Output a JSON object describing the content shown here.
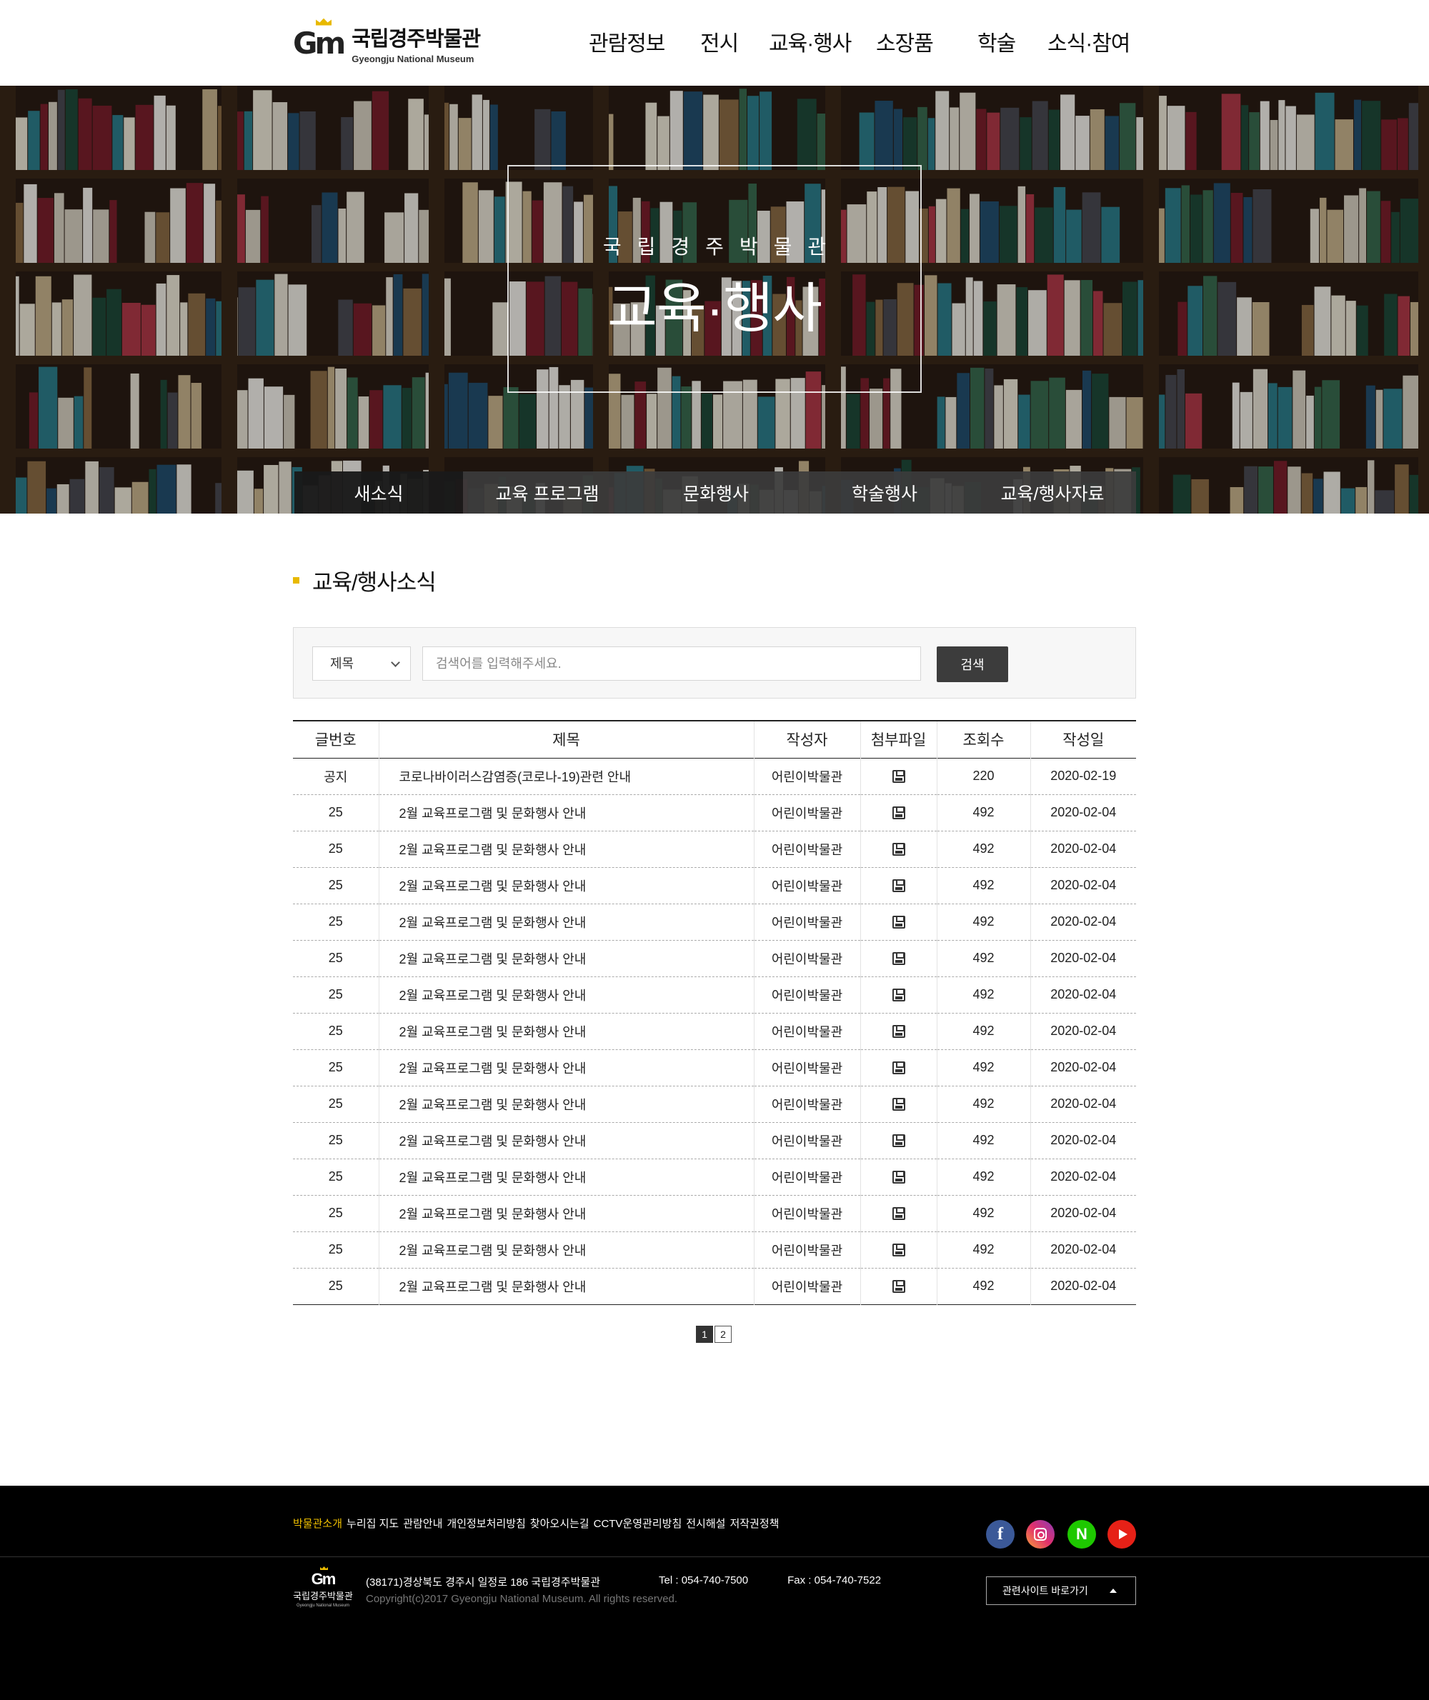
{
  "header": {
    "logo_mark": "Gm",
    "logo_ko": "국립경주박물관",
    "logo_en": "Gyeongju National Museum",
    "gnb": [
      "관람정보",
      "전시",
      "교육·행사",
      "소장품",
      "학술",
      "소식·참여"
    ]
  },
  "hero": {
    "subtitle": "국립경주박물관",
    "title": "교육·행사",
    "tabs": [
      "새소식",
      "교육 프로그램",
      "문화행사",
      "학술행사",
      "교육/행사자료"
    ],
    "active_tab": 0
  },
  "section": {
    "title": "교육/행사소식",
    "accent_color": "#e8b900"
  },
  "search": {
    "select_value": "제목",
    "placeholder": "검색어를 입력해주세요.",
    "button": "검색"
  },
  "board": {
    "columns": [
      "글번호",
      "제목",
      "작성자",
      "첨부파일",
      "조회수",
      "작성일"
    ],
    "rows": [
      {
        "num": "공지",
        "title": "코로나바이러스감염증(코로나-19)관련 안내",
        "author": "어린이박물관",
        "views": "220",
        "date": "2020-02-19"
      },
      {
        "num": "25",
        "title": "2월 교육프로그램 및 문화행사 안내",
        "author": "어린이박물관",
        "views": "492",
        "date": "2020-02-04"
      },
      {
        "num": "25",
        "title": "2월 교육프로그램 및 문화행사 안내",
        "author": "어린이박물관",
        "views": "492",
        "date": "2020-02-04"
      },
      {
        "num": "25",
        "title": "2월 교육프로그램 및 문화행사 안내",
        "author": "어린이박물관",
        "views": "492",
        "date": "2020-02-04"
      },
      {
        "num": "25",
        "title": "2월 교육프로그램 및 문화행사 안내",
        "author": "어린이박물관",
        "views": "492",
        "date": "2020-02-04"
      },
      {
        "num": "25",
        "title": "2월 교육프로그램 및 문화행사 안내",
        "author": "어린이박물관",
        "views": "492",
        "date": "2020-02-04"
      },
      {
        "num": "25",
        "title": "2월 교육프로그램 및 문화행사 안내",
        "author": "어린이박물관",
        "views": "492",
        "date": "2020-02-04"
      },
      {
        "num": "25",
        "title": "2월 교육프로그램 및 문화행사 안내",
        "author": "어린이박물관",
        "views": "492",
        "date": "2020-02-04"
      },
      {
        "num": "25",
        "title": "2월 교육프로그램 및 문화행사 안내",
        "author": "어린이박물관",
        "views": "492",
        "date": "2020-02-04"
      },
      {
        "num": "25",
        "title": "2월 교육프로그램 및 문화행사 안내",
        "author": "어린이박물관",
        "views": "492",
        "date": "2020-02-04"
      },
      {
        "num": "25",
        "title": "2월 교육프로그램 및 문화행사 안내",
        "author": "어린이박물관",
        "views": "492",
        "date": "2020-02-04"
      },
      {
        "num": "25",
        "title": "2월 교육프로그램 및 문화행사 안내",
        "author": "어린이박물관",
        "views": "492",
        "date": "2020-02-04"
      },
      {
        "num": "25",
        "title": "2월 교육프로그램 및 문화행사 안내",
        "author": "어린이박물관",
        "views": "492",
        "date": "2020-02-04"
      },
      {
        "num": "25",
        "title": "2월 교육프로그램 및 문화행사 안내",
        "author": "어린이박물관",
        "views": "492",
        "date": "2020-02-04"
      },
      {
        "num": "25",
        "title": "2월 교육프로그램 및 문화행사 안내",
        "author": "어린이박물관",
        "views": "492",
        "date": "2020-02-04"
      }
    ]
  },
  "paging": {
    "pages": [
      "1",
      "2"
    ],
    "current": "1"
  },
  "footer": {
    "links": [
      "박물관소개",
      "누리집 지도",
      "관람안내",
      "개인정보처리방침",
      "찾아오시는길",
      "CCTV운영관리방침",
      "전시해설",
      "저작권정책"
    ],
    "highlight_color": "#f0c000",
    "sns": [
      "facebook-icon",
      "instagram-icon",
      "naver-icon",
      "youtube-icon"
    ],
    "naver_letter": "N",
    "facebook_letter": "f",
    "logo_mark": "Gm",
    "logo_ko": "국립경주박물관",
    "logo_en": "Gyeongju National Museum",
    "address": "(38171)경상북도 경주시 일정로 186 국립경주박물관",
    "tel": "Tel : 054-740-7500",
    "fax": "Fax : 054-740-7522",
    "copyright": "Copyright(c)2017 Gyeongju National Museum. All rights reserved.",
    "family_site": "관련사이트 바로가기"
  }
}
